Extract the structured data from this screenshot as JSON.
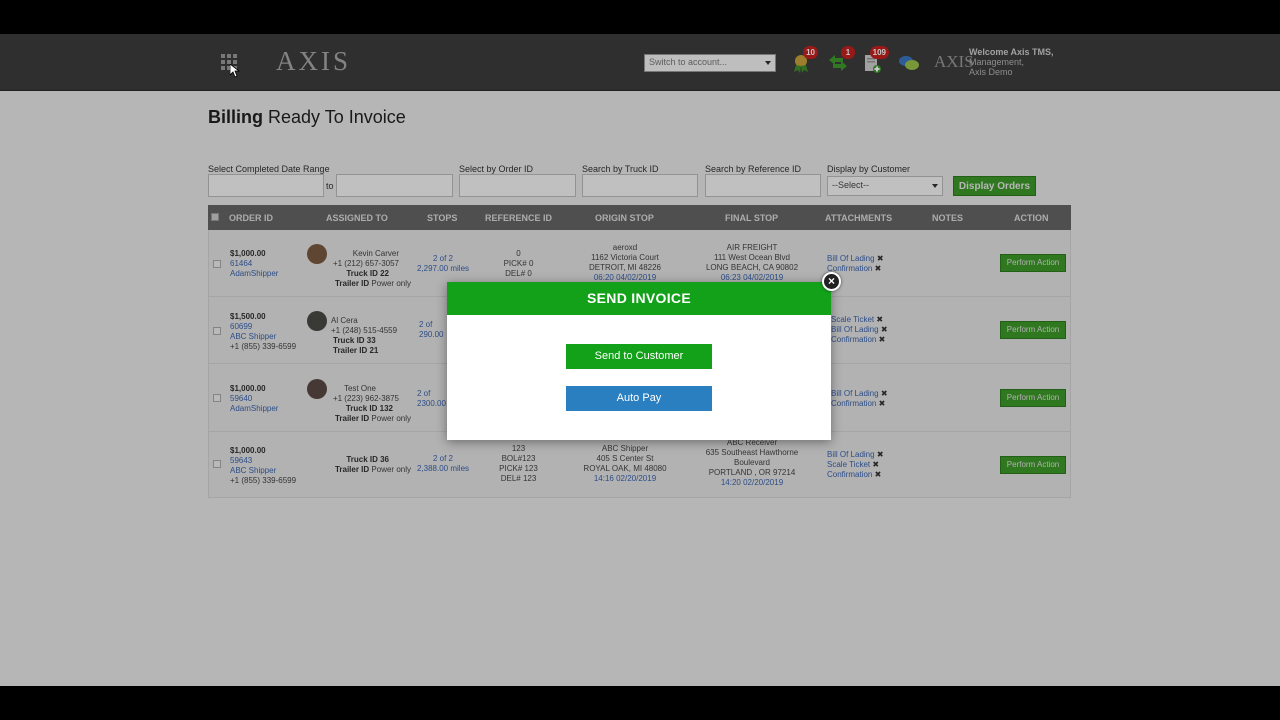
{
  "header": {
    "logo": "AXIS",
    "account_select": "Switch to account...",
    "badges": {
      "alerts": "10",
      "messages": "1",
      "documents": "109"
    },
    "mini_logo": "AXIS",
    "welcome_line1": "Welcome Axis TMS,",
    "welcome_line2": "Management,",
    "welcome_line3": "Axis Demo"
  },
  "page": {
    "title_bold": "Billing",
    "title_rest": " Ready To Invoice"
  },
  "filters": {
    "date_range_label": "Select Completed Date Range",
    "to_label": "to",
    "order_id_label": "Select by Order ID",
    "truck_id_label": "Search by Truck ID",
    "reference_id_label": "Search by Reference ID",
    "customer_label": "Display by Customer",
    "customer_select": "--Select--",
    "display_button": "Display Orders"
  },
  "table": {
    "columns": [
      "ORDER ID",
      "ASSIGNED TO",
      "STOPS",
      "REFERENCE ID",
      "ORIGIN STOP",
      "FINAL STOP",
      "ATTACHMENTS",
      "NOTES",
      "ACTION"
    ],
    "rows": [
      {
        "amount": "$1,000.00",
        "order_id": "61464",
        "shipper": "AdamShipper",
        "phone": "",
        "driver": "Kevin Carver",
        "driver_phone": "+1 (212) 657-3057",
        "truck": "Truck ID 22",
        "trailer_label": "Trailer ID",
        "trailer": "Power only",
        "stops": "2 of 2",
        "miles": "2,297.00 miles",
        "ref1": "0",
        "ref2": "PICK# 0",
        "ref3": "DEL# 0",
        "origin1": "aeroxd",
        "origin2": "1162 Victoria Court",
        "origin3": "DETROIT, MI 48226",
        "origin4": "06:20 04/02/2019",
        "final1": "AIR FREIGHT",
        "final2": "111 West Ocean Blvd",
        "final3": "LONG BEACH, CA 90802",
        "final4": "06:23 04/02/2019",
        "att1": "Bill Of Lading",
        "att2": "Confirmation",
        "att3": "",
        "action": "Perform Action"
      },
      {
        "amount": "$1,500.00",
        "order_id": "60699",
        "shipper": "ABC Shipper",
        "phone": "+1 (855) 339-6599",
        "driver": "Al Cera",
        "driver_phone": "+1 (248) 515-4559",
        "truck": "Truck ID 33",
        "trailer_label": "Trailer ID",
        "trailer": "21",
        "stops": "2 of",
        "miles": "290.00",
        "att1": "Scale Ticket",
        "att2": "Bill Of Lading",
        "att3": "Confirmation",
        "action": "Perform Action"
      },
      {
        "amount": "$1,000.00",
        "order_id": "59640",
        "shipper": "AdamShipper",
        "phone": "",
        "driver": "Test One",
        "driver_phone": "+1 (223) 962-3875",
        "truck": "Truck ID 132",
        "trailer_label": "Trailer ID",
        "trailer": "Power only",
        "stops": "2 of",
        "miles": "2300.00",
        "att1": "Bill Of Lading",
        "att2": "Confirmation",
        "att3": "",
        "action": "Perform Action"
      },
      {
        "amount": "$1,000.00",
        "order_id": "59643",
        "shipper": "ABC Shipper",
        "phone": "+1 (855) 339-6599",
        "truck": "Truck ID 36",
        "trailer_label": "Trailer ID",
        "trailer": "Power only",
        "stops": "2 of 2",
        "miles": "2,388.00 miles",
        "ref1": "123",
        "ref2": "BOL#123",
        "ref3": "PICK# 123",
        "ref4": "DEL# 123",
        "origin1": "ABC Shipper",
        "origin2": "405 S Center St",
        "origin3": "ROYAL OAK, MI 48080",
        "origin4": "14:16 02/20/2019",
        "final1": "ABC Receiver",
        "final2": "635 Southeast Hawthorne",
        "final3": "Boulevard",
        "final4": "PORTLAND , OR 97214",
        "final5": "14:20 02/20/2019",
        "att1": "Bill Of Lading",
        "att2": "Scale Ticket",
        "att3": "Confirmation",
        "action": "Perform Action"
      }
    ]
  },
  "modal": {
    "title": "SEND INVOICE",
    "close": "×",
    "send_button": "Send to Customer",
    "autopay_button": "Auto Pay"
  },
  "colors": {
    "brand_green": "#13a11a",
    "action_green": "#3e9a2a",
    "autopay_blue": "#2a7fc1",
    "link_blue": "#3a64b0",
    "badge_red": "#c42020"
  }
}
